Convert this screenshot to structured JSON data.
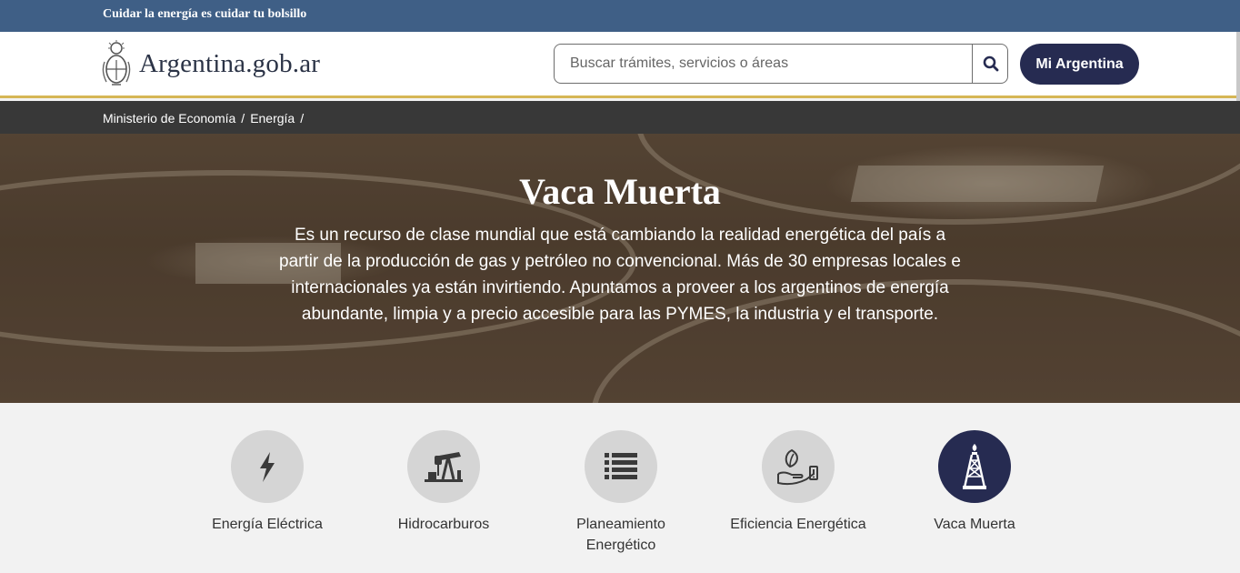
{
  "topbar": {
    "text": "Cuidar la energía es cuidar tu bolsillo"
  },
  "header": {
    "logo_text": "Argentina.gob.ar",
    "search_placeholder": "Buscar trámites, servicios o áreas",
    "mi_argentina_label": "Mi Argentina"
  },
  "breadcrumb": {
    "items": [
      {
        "label": "Ministerio de Economía"
      },
      {
        "label": "Energía"
      }
    ],
    "separator": "/"
  },
  "hero": {
    "title": "Vaca Muerta",
    "description": "Es un recurso de clase mundial que está cambiando la realidad energética del país a partir de la producción de gas y petróleo no convencional. Más de 30 empresas locales e internacionales ya están invirtiendo. Apuntamos a proveer a los argentinos de energía abundante, limpia y a precio accesible para las PYMES, la industria y el transporte."
  },
  "cards": [
    {
      "label": "Energía Eléctrica",
      "icon": "lightning-icon",
      "active": false
    },
    {
      "label": "Hidrocarburos",
      "icon": "oil-pump-icon",
      "active": false
    },
    {
      "label": "Planeamiento Energético",
      "icon": "list-icon",
      "active": false
    },
    {
      "label": "Eficiencia Energética",
      "icon": "hand-leaf-icon",
      "active": false
    },
    {
      "label": "Vaca Muerta",
      "icon": "oil-derrick-icon",
      "active": true
    }
  ],
  "colors": {
    "topbar": "#3f5f86",
    "primary": "#262b51",
    "accent_line": "#d6b655",
    "breadcrumb_bg": "#383838",
    "icon_circle": "#d5d5d5"
  }
}
